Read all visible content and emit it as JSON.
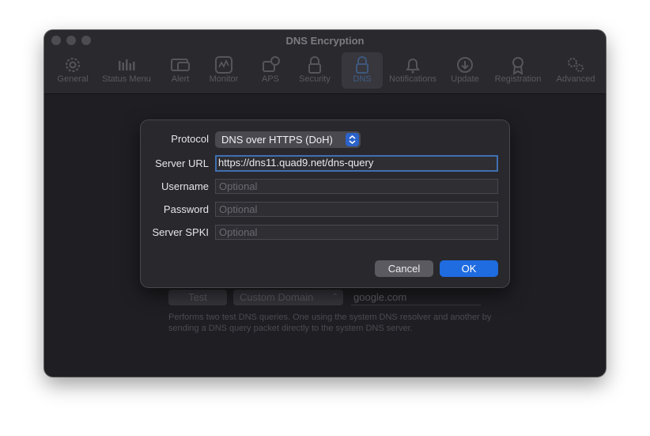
{
  "window": {
    "title": "DNS Encryption"
  },
  "toolbar": {
    "tabs": [
      {
        "label": "General",
        "icon": "gear-icon"
      },
      {
        "label": "Status Menu",
        "icon": "status-menu-icon"
      },
      {
        "label": "Alert",
        "icon": "alert-icon"
      },
      {
        "label": "Monitor",
        "icon": "monitor-icon"
      },
      {
        "label": "APS",
        "icon": "aps-icon"
      },
      {
        "label": "Security",
        "icon": "lock-icon"
      },
      {
        "label": "DNS",
        "icon": "dns-lock-icon"
      },
      {
        "label": "Notifications",
        "icon": "bell-icon"
      },
      {
        "label": "Update",
        "icon": "download-icon"
      },
      {
        "label": "Registration",
        "icon": "ribbon-icon"
      },
      {
        "label": "Advanced",
        "icon": "gears-icon"
      }
    ],
    "active_tab": "DNS"
  },
  "background": {
    "test_button": "Test",
    "domain_type": "Custom Domain",
    "domain_value": "google.com",
    "description": "Performs two test DNS queries. One using the system DNS resolver and another by sending a DNS query packet directly to the system DNS server."
  },
  "sheet": {
    "protocol_label": "Protocol",
    "protocol_value": "DNS over HTTPS (DoH)",
    "server_url_label": "Server URL",
    "server_url_value": "https://dns11.quad9.net/dns-query",
    "username_label": "Username",
    "username_placeholder": "Optional",
    "password_label": "Password",
    "password_placeholder": "Optional",
    "spki_label": "Server SPKI",
    "spki_placeholder": "Optional",
    "cancel_label": "Cancel",
    "ok_label": "OK"
  },
  "colors": {
    "accent": "#1f6be0",
    "window_bg": "#1f1e23",
    "sheet_bg": "#29282d",
    "focus_ring": "#3f6fb1"
  }
}
